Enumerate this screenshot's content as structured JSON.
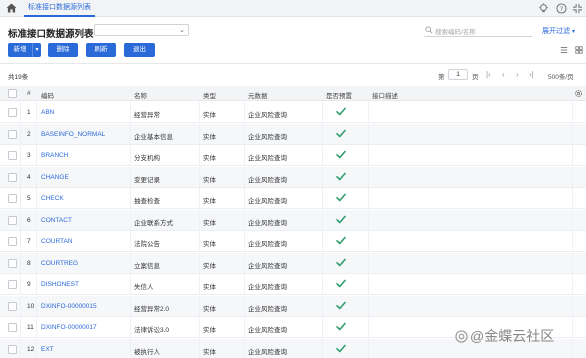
{
  "tabbar": {
    "tab_label": "标准接口数据源列表"
  },
  "header": {
    "title": "标准接口数据源列表",
    "search_placeholder": "搜索编码/名称",
    "filter_label": "展开过滤",
    "filter_caret": "▾"
  },
  "toolbar": {
    "new_label": "新增",
    "new_caret": "▾",
    "delete_label": "删除",
    "refresh_label": "刷新",
    "exit_label": "退出"
  },
  "pager": {
    "total": "共19条",
    "page_prefix": "第",
    "page_value": "1",
    "page_suffix": "页",
    "page_size": "500条/页",
    "first": "|‹",
    "prev": "‹",
    "next": "›",
    "last": "›|"
  },
  "table": {
    "columns": {
      "index": "#",
      "code": "编码",
      "name": "名称",
      "type": "类型",
      "meta": "元数据",
      "preset": "是否预置",
      "desc": "接口描述"
    },
    "rows": [
      {
        "index": "1",
        "code": "ABN",
        "name": "经营异常",
        "type": "实体",
        "meta": "企业风险查询",
        "preset": true
      },
      {
        "index": "2",
        "code": "BASEINFO_NORMAL",
        "name": "企业基本信息",
        "type": "实体",
        "meta": "企业风险查询",
        "preset": true
      },
      {
        "index": "3",
        "code": "BRANCH",
        "name": "分支机构",
        "type": "实体",
        "meta": "企业风险查询",
        "preset": true
      },
      {
        "index": "4",
        "code": "CHANGE",
        "name": "变更记录",
        "type": "实体",
        "meta": "企业风险查询",
        "preset": true
      },
      {
        "index": "5",
        "code": "CHECK",
        "name": "抽查检查",
        "type": "实体",
        "meta": "企业风险查询",
        "preset": true
      },
      {
        "index": "6",
        "code": "CONTACT",
        "name": "企业联系方式",
        "type": "实体",
        "meta": "企业风险查询",
        "preset": true
      },
      {
        "index": "7",
        "code": "COURTAN",
        "name": "法院公告",
        "type": "实体",
        "meta": "企业风险查询",
        "preset": true
      },
      {
        "index": "8",
        "code": "COURTREG",
        "name": "立案信息",
        "type": "实体",
        "meta": "企业风险查询",
        "preset": true
      },
      {
        "index": "9",
        "code": "DISHONEST",
        "name": "失信人",
        "type": "实体",
        "meta": "企业风险查询",
        "preset": true
      },
      {
        "index": "10",
        "code": "DXINFO-00000015",
        "name": "经营异常2.0",
        "type": "实体",
        "meta": "企业风险查询",
        "preset": true
      },
      {
        "index": "11",
        "code": "DXINFO-00000017",
        "name": "法律诉讼3.0",
        "type": "实体",
        "meta": "企业风险查询",
        "preset": true
      },
      {
        "index": "12",
        "code": "EXT",
        "name": "被执行人",
        "type": "实体",
        "meta": "企业风险查询",
        "preset": true
      }
    ]
  },
  "watermark": {
    "text": "@金蝶云社区"
  },
  "colors": {
    "accent": "#2a6ad8",
    "check": "#2f9e6e"
  }
}
